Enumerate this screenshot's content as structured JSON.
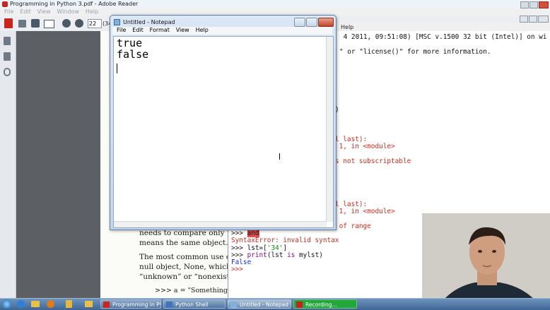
{
  "reader": {
    "title": "Programming in Python 3.pdf - Adobe Reader",
    "menu": [
      "File",
      "Edit",
      "View",
      "Window",
      "Help"
    ],
    "page_number": "22",
    "page_of_partial": "(34"
  },
  "pdf_page": {
    "lines": [
      "needs to compare only th",
      "means the same object.",
      "The most common use c",
      "null object, None, which",
      "“unknown” or “nonexiste",
      ">>> a = \"Something\""
    ]
  },
  "shell": {
    "menu_help": "Help",
    "lines": [
      {
        "text": " 4 2011, 09:51:08) [MSC v.1500 32 bit (Intel)] on wi",
        "color": "blk"
      },
      {
        "text": "\" or \"license()\" for more information.",
        "color": "blk"
      },
      {
        "text": ")",
        "color": "blk"
      },
      {
        "text": "l last):",
        "color": "red"
      },
      {
        "text": " 1, in <module>",
        "color": "red"
      },
      {
        "text": "s not subscriptable",
        "color": "red"
      },
      {
        "text": "l last):",
        "color": "red"
      },
      {
        "text": " 1, in <module>",
        "color": "red"
      },
      {
        "text": " of range",
        "color": "red"
      }
    ],
    "prompt": ">>>",
    "and_keyword": "and",
    "syntax_error": "SyntaxError: invalid syntax",
    "lst_prefix": "lst=[",
    "lst_string": "'34'",
    "lst_suffix": "]",
    "print_kw": "print",
    "print_open": "(lst ",
    "is_kw": "is",
    "print_close": " mylst)",
    "output_false": "False"
  },
  "notepad": {
    "title": "Untitled - Notepad",
    "menu": [
      "File",
      "Edit",
      "Format",
      "View",
      "Help"
    ],
    "text_lines": [
      "true",
      "false"
    ]
  },
  "taskbar": {
    "tasks": [
      {
        "label": "Programming in Pyt...",
        "icon_color": "#c8261c"
      },
      {
        "label": "Python Shell",
        "icon_color": "#3f74b8"
      },
      {
        "label": "Untitled - Notepad",
        "icon_color": "#7fb1e0"
      },
      {
        "label": "Recording...",
        "icon_color": "#c42222"
      }
    ]
  },
  "colors": {
    "code_red": "#d12b1f",
    "keyword_purple": "#8b0b8b",
    "string_green": "#0c8a0c",
    "output_blue": "#1a2ad6",
    "recording_task_green": "#23a73a"
  }
}
